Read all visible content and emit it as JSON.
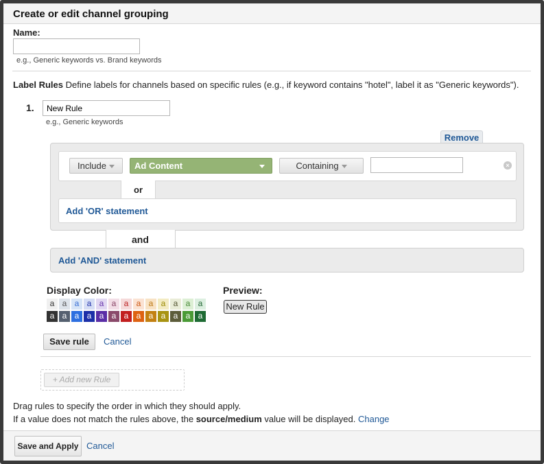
{
  "dialog": {
    "title": "Create or edit channel grouping"
  },
  "name": {
    "label": "Name:",
    "value": "",
    "placeholder": "",
    "hint": "e.g., Generic keywords vs. Brand keywords"
  },
  "label_rules": {
    "heading": "Label Rules",
    "description": "Define labels for channels based on specific rules (e.g., if keyword contains \"hotel\", label it as \"Generic keywords\")."
  },
  "rule": {
    "number": "1.",
    "name_value": "New Rule",
    "hint": "e.g., Generic keywords",
    "remove_label": "Remove",
    "condition": {
      "include_label": "Include",
      "dimension_label": "Ad Content",
      "match_label": "Containing",
      "value": ""
    },
    "or_label": "or",
    "add_or_label": "Add 'OR' statement",
    "and_label": "and",
    "add_and_label": "Add 'AND' statement",
    "display_color_label": "Display Color:",
    "preview_label": "Preview:",
    "preview_chip": "New Rule",
    "swatch_glyph": "a",
    "swatches_light": [
      {
        "bg": "#f0f0f0",
        "fg": "#333333"
      },
      {
        "bg": "#dde3ea",
        "fg": "#555555"
      },
      {
        "bg": "#d6e4f7",
        "fg": "#3b6fd4"
      },
      {
        "bg": "#d5ddf5",
        "fg": "#2233aa"
      },
      {
        "bg": "#e1d7f2",
        "fg": "#6633aa"
      },
      {
        "bg": "#f2dde6",
        "fg": "#884466"
      },
      {
        "bg": "#f5d9d9",
        "fg": "#bb2222"
      },
      {
        "bg": "#fbe2d2",
        "fg": "#cc5511"
      },
      {
        "bg": "#f8e2c4",
        "fg": "#bb7711"
      },
      {
        "bg": "#f3ebc2",
        "fg": "#998800"
      },
      {
        "bg": "#e9ecd7",
        "fg": "#555533"
      },
      {
        "bg": "#dcefd4",
        "fg": "#448833"
      },
      {
        "bg": "#dcefe0",
        "fg": "#226633"
      }
    ],
    "swatches_dark": [
      {
        "bg": "#333333",
        "fg": "#ffffff"
      },
      {
        "bg": "#556070",
        "fg": "#ffffff"
      },
      {
        "bg": "#2d6fe0",
        "fg": "#ffffff"
      },
      {
        "bg": "#1c2fa8",
        "fg": "#ffffff"
      },
      {
        "bg": "#5b2ea6",
        "fg": "#ffffff"
      },
      {
        "bg": "#8a4a6a",
        "fg": "#ffffff"
      },
      {
        "bg": "#c21f1f",
        "fg": "#ffffff"
      },
      {
        "bg": "#de6212",
        "fg": "#ffffff"
      },
      {
        "bg": "#c38011",
        "fg": "#ffffff"
      },
      {
        "bg": "#a89312",
        "fg": "#ffffff"
      },
      {
        "bg": "#5c5c3a",
        "fg": "#ffffff"
      },
      {
        "bg": "#4a9a36",
        "fg": "#ffffff"
      },
      {
        "bg": "#1e6b34",
        "fg": "#ffffff"
      }
    ],
    "save_rule_label": "Save rule",
    "cancel_label": "Cancel"
  },
  "add_new_rule_label": "+ Add new Rule",
  "notes": {
    "drag": "Drag rules to specify the order in which they should apply.",
    "fallback_pre": "If a value does not match the rules above, the",
    "fallback_bold": "source/medium",
    "fallback_post": "value will be displayed.",
    "change_link": "Change"
  },
  "footer": {
    "save_apply_label": "Save and Apply",
    "cancel_label": "Cancel"
  },
  "colors": {
    "link": "#1f5896",
    "dimension_bg": "#95b475",
    "panel_bg": "#ebebeb"
  }
}
